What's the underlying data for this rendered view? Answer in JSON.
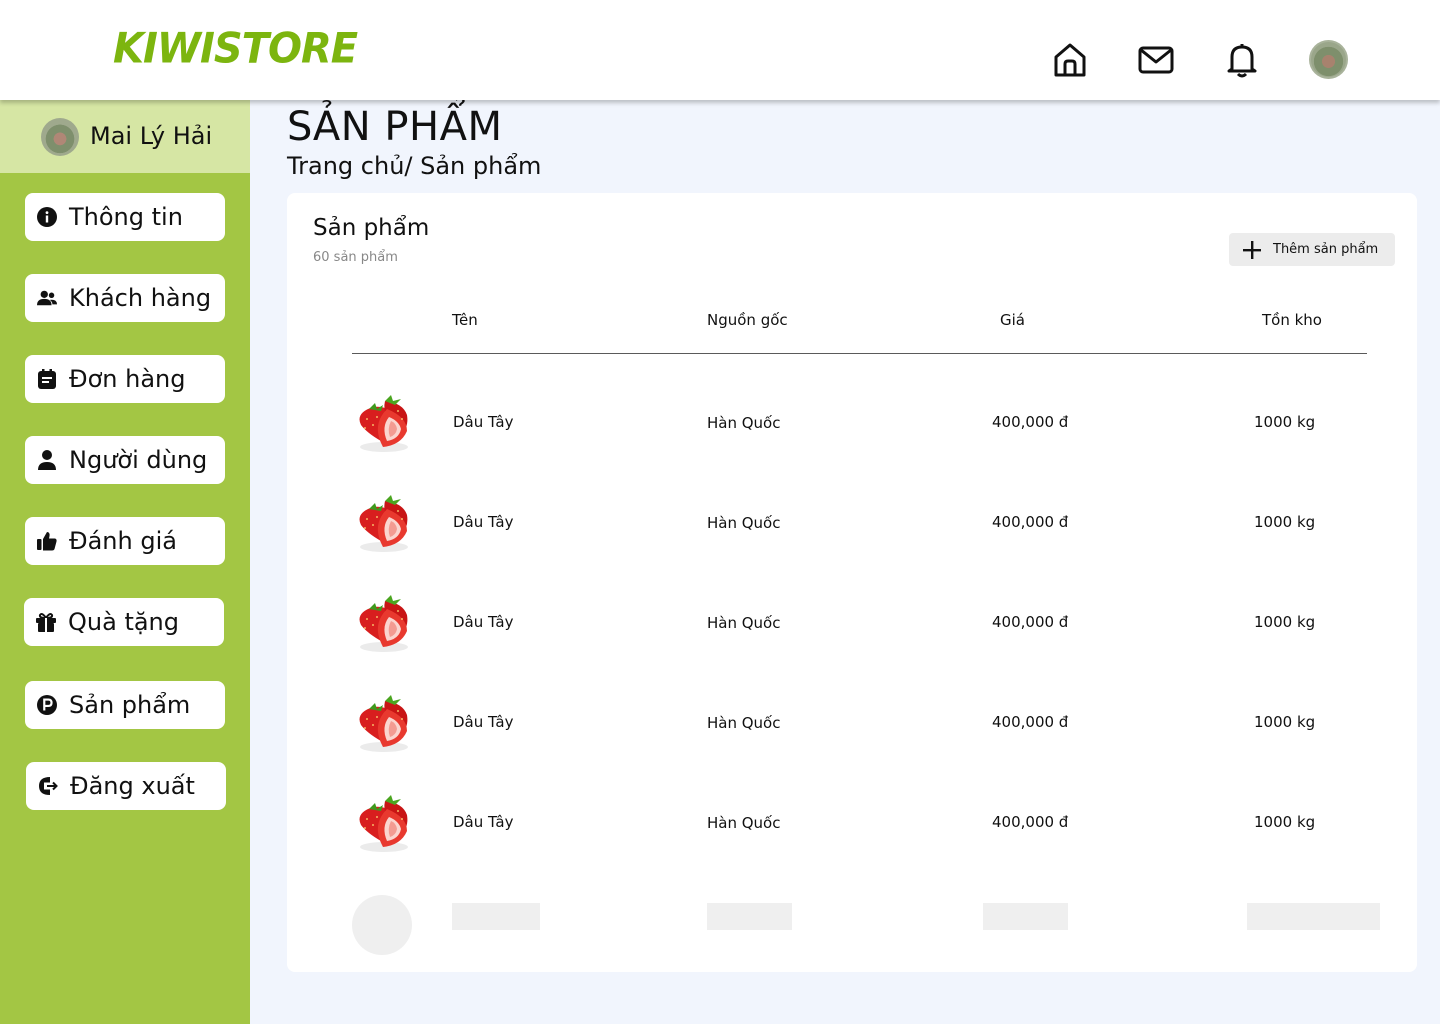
{
  "app": {
    "logo": "KIWISTORE",
    "accent": "#7cb50f",
    "sidebar_color": "#a3c644",
    "profile_bg": "#d6e6a4"
  },
  "header": {
    "icons": [
      "home-icon",
      "mail-icon",
      "bell-icon",
      "avatar"
    ]
  },
  "sidebar": {
    "user_name": "Mai Lý Hải",
    "items": [
      {
        "label": "Thông tin",
        "icon": "info-icon"
      },
      {
        "label": "Khách hàng",
        "icon": "users-icon"
      },
      {
        "label": "Đơn hàng",
        "icon": "order-icon"
      },
      {
        "label": "Người dùng",
        "icon": "user-icon"
      },
      {
        "label": "Đánh giá",
        "icon": "thumbs-up-icon"
      },
      {
        "label": "Quà tặng",
        "icon": "gift-icon"
      },
      {
        "label": "Sản phẩm",
        "icon": "product-icon"
      },
      {
        "label": "Đăng xuất",
        "icon": "logout-icon"
      }
    ]
  },
  "main": {
    "title": "SẢN PHẨM",
    "breadcrumb": "Trang chủ/ Sản phẩm",
    "card": {
      "title": "Sản phẩm",
      "subtitle": "60 sản phẩm",
      "add_button": "Thêm sản phẩm"
    },
    "table": {
      "columns": [
        "Tên",
        "Nguồn gốc",
        "Giá",
        "Tồn kho"
      ],
      "rows": [
        {
          "name": "Dâu Tây",
          "origin": "Hàn Quốc",
          "price": "400,000 đ",
          "stock": "1000 kg"
        },
        {
          "name": "Dâu Tây",
          "origin": "Hàn Quốc",
          "price": "400,000 đ",
          "stock": "1000 kg"
        },
        {
          "name": "Dâu Tây",
          "origin": "Hàn Quốc",
          "price": "400,000 đ",
          "stock": "1000 kg"
        },
        {
          "name": "Dâu Tây",
          "origin": "Hàn Quốc",
          "price": "400,000 đ",
          "stock": "1000 kg"
        },
        {
          "name": "Dâu Tây",
          "origin": "Hàn Quốc",
          "price": "400,000 đ",
          "stock": "1000 kg"
        }
      ]
    }
  }
}
